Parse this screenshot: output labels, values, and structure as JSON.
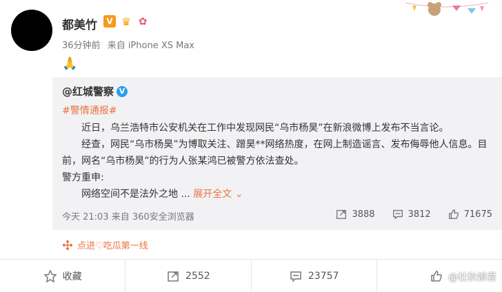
{
  "post": {
    "username": "都美竹",
    "badges": {
      "v": "V",
      "crown": "♛",
      "gift": "✿"
    },
    "time": "36分钟前",
    "source": "来自 iPhone XS Max",
    "body_emoji": "🙏"
  },
  "repost": {
    "user": "@红城警察",
    "verified": "V",
    "hashtag": "#警情通报#",
    "p1": "近日，乌兰浩特市公安机关在工作中发现网民“乌市杨昊”在新浪微博上发布不当言论。",
    "p2": "经查，网民“乌市杨昊”为博取关注、蹭昊**网络热度，在网上制造谣言、发布侮辱他人信息。目前，网名“乌市杨昊”的行为人张某鸿已被警方依法查处。",
    "p3": "警方重申:",
    "p4": "网络空间不是法外之地 ...",
    "expand": "展开全文",
    "time": "今天 21:03",
    "source": "来自 360安全浏览器",
    "stats": {
      "repost": "3888",
      "comment": "3812",
      "like": "71675"
    }
  },
  "promo": {
    "text": "点进♡吃瓜第一线"
  },
  "actions": {
    "favorite": "收藏",
    "repost": "2552",
    "comment": "23757",
    "like": ""
  },
  "watermark": "@杜秋娘君",
  "colors": {
    "accent": "#eb7340",
    "verified_blue": "#2c9fe9",
    "gold_v": "#f79a1b"
  }
}
